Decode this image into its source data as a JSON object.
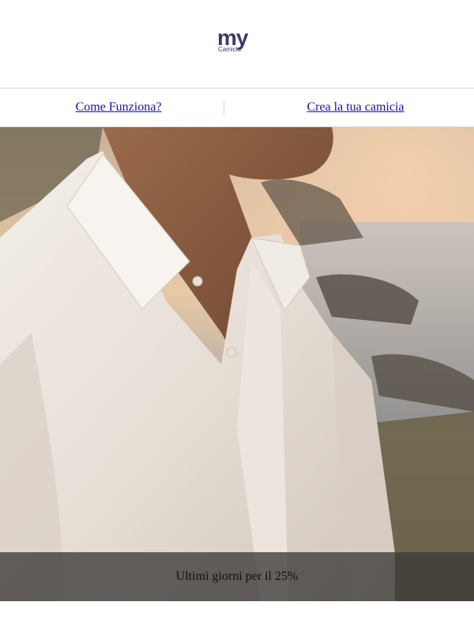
{
  "header": {
    "logo_text": "my",
    "logo_subtext": "Camicia"
  },
  "nav": {
    "items": [
      {
        "label": "Come Funziona?"
      },
      {
        "label": "Crea la tua camicia"
      }
    ]
  },
  "hero": {
    "image_description": "man wearing white linen shirt at seaside sunset",
    "banner_text": "Ultimi giorni per il 25%"
  },
  "colors": {
    "link": "#1a0dab",
    "logo": "#3a3a6a",
    "divider": "#d7d7d7"
  }
}
